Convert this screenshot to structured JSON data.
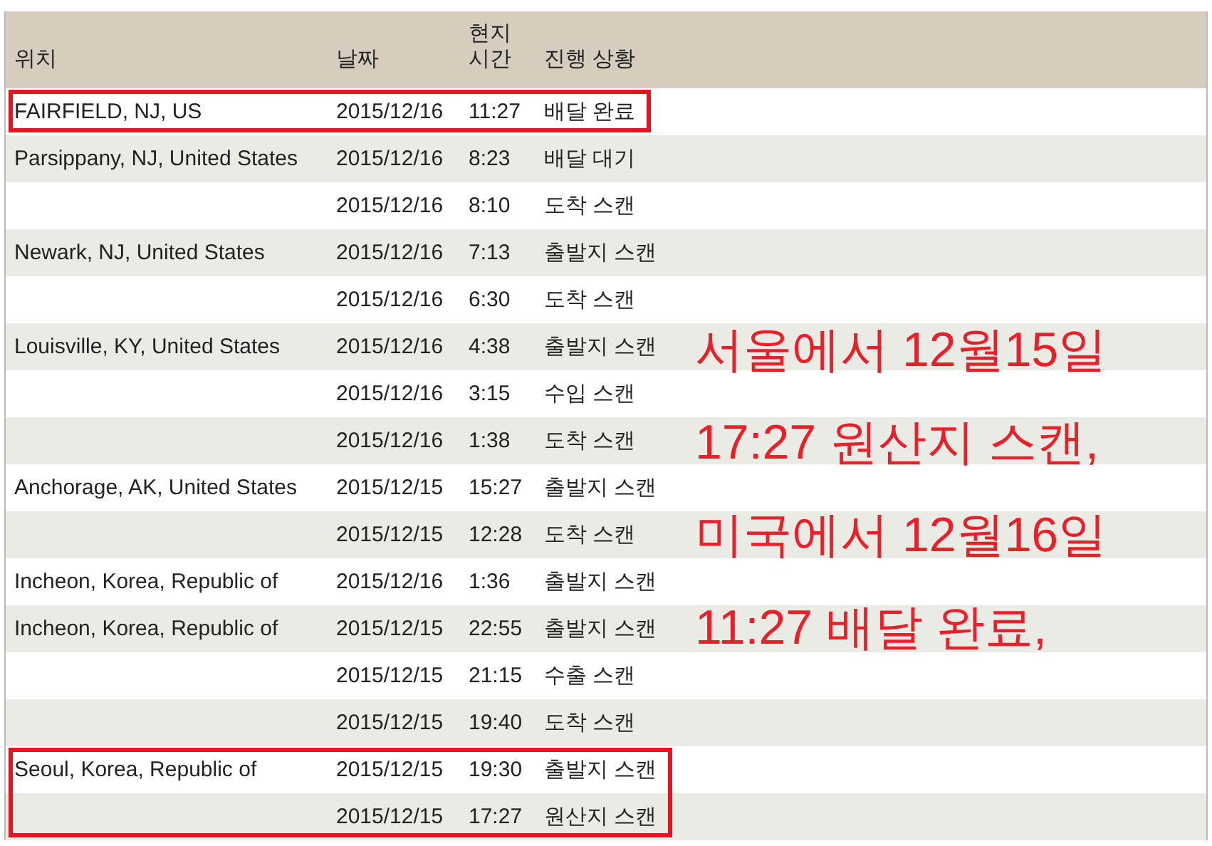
{
  "table": {
    "columns": [
      {
        "label": "위치"
      },
      {
        "label": "날짜"
      },
      {
        "label": "현지\n시간"
      },
      {
        "label": "진행 상황"
      }
    ],
    "rows": [
      {
        "location": "FAIRFIELD, NJ, US",
        "date": "2015/12/16",
        "time": "11:27",
        "status": "배달 완료",
        "boxed": true
      },
      {
        "location": "Parsippany, NJ, United States",
        "date": "2015/12/16",
        "time": "8:23",
        "status": "배달 대기",
        "boxed": false
      },
      {
        "location": "",
        "date": "2015/12/16",
        "time": "8:10",
        "status": "도착 스캔",
        "boxed": false
      },
      {
        "location": "Newark, NJ, United States",
        "date": "2015/12/16",
        "time": "7:13",
        "status": "출발지 스캔",
        "boxed": false
      },
      {
        "location": "",
        "date": "2015/12/16",
        "time": "6:30",
        "status": "도착 스캔",
        "boxed": false
      },
      {
        "location": "Louisville, KY, United States",
        "date": "2015/12/16",
        "time": "4:38",
        "status": "출발지 스캔",
        "boxed": false
      },
      {
        "location": "",
        "date": "2015/12/16",
        "time": "3:15",
        "status": "수입 스캔",
        "boxed": false
      },
      {
        "location": "",
        "date": "2015/12/16",
        "time": "1:38",
        "status": "도착 스캔",
        "boxed": false
      },
      {
        "location": "Anchorage, AK, United States",
        "date": "2015/12/15",
        "time": "15:27",
        "status": "출발지 스캔",
        "boxed": false
      },
      {
        "location": "",
        "date": "2015/12/15",
        "time": "12:28",
        "status": "도착 스캔",
        "boxed": false
      },
      {
        "location": "Incheon, Korea, Republic of",
        "date": "2015/12/16",
        "time": "1:36",
        "status": "출발지 스캔",
        "boxed": false
      },
      {
        "location": "Incheon, Korea, Republic of",
        "date": "2015/12/15",
        "time": "22:55",
        "status": "출발지 스캔",
        "boxed": false
      },
      {
        "location": "",
        "date": "2015/12/15",
        "time": "21:15",
        "status": "수출 스캔",
        "boxed": false
      },
      {
        "location": "",
        "date": "2015/12/15",
        "time": "19:40",
        "status": "도착 스캔",
        "boxed": false
      },
      {
        "location": "Seoul, Korea, Republic of",
        "date": "2015/12/15",
        "time": "19:30",
        "status": "출발지 스캔",
        "boxed": true
      },
      {
        "location": "",
        "date": "2015/12/15",
        "time": "17:27",
        "status": "원산지 스캔",
        "boxed": true
      }
    ]
  },
  "annotation": {
    "lines": [
      "서울에서 12월15일",
      "17:27 원산지 스캔,",
      "미국에서 12월16일",
      "11:27 배달 완료,"
    ]
  }
}
